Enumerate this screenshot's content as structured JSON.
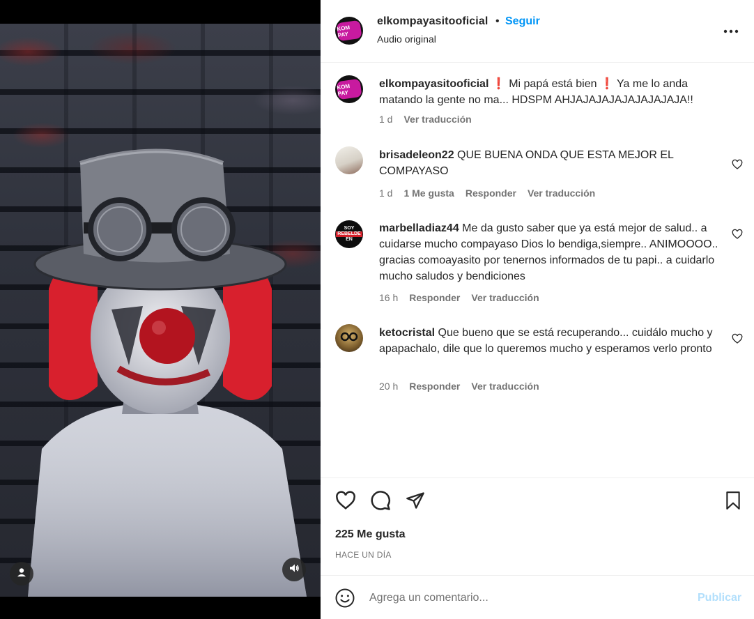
{
  "header": {
    "username": "elkompayasitooficial",
    "separator": "•",
    "follow_label": "Seguir",
    "subtitle": "Audio original",
    "avatar_text": "KOM PAY"
  },
  "comments": [
    {
      "username": "elkompayasitooficial",
      "text": " ❗ Mi papá está bien ❗ Ya me lo anda matando la gente no ma... HDSPM AHJAJAJAJAJAJAJAJAJA!!",
      "time": "1 d",
      "translate": "Ver traducción"
    },
    {
      "username": "brisadeleon22",
      "text": " QUE BUENA ONDA QUE ESTA MEJOR EL COMPAYASO",
      "time": "1 d",
      "likes": "1 Me gusta",
      "reply": "Responder",
      "translate": "Ver traducción"
    },
    {
      "username": "marbelladiaz44",
      "text": " Me da gusto saber que ya está mejor de salud.. a cuidarse mucho compayaso Dios lo bendiga,siempre.. ANIMOOOO.. gracias comoayasito por tenernos informados de tu papi.. a cuidarlo mucho saludos y bendiciones",
      "time": "16 h",
      "reply": "Responder",
      "translate": "Ver traducción",
      "avatar_text_1": "SOY",
      "avatar_text_2": "REBELDE",
      "avatar_text_3": "EN"
    },
    {
      "username": "ketocristal",
      "text": " Que bueno que se está recuperando... cuidálo mucho y apapachalo, dile que lo queremos mucho y esperamos verlo pronto",
      "time": "20 h",
      "reply": "Responder",
      "translate": "Ver traducción"
    }
  ],
  "footer": {
    "likes": "225 Me gusta",
    "posted": "HACE UN DÍA",
    "comment_placeholder": "Agrega un comentario...",
    "publish_label": "Publicar"
  },
  "colors": {
    "accent": "#0095f6",
    "publish_disabled": "#b2dffc",
    "brand_pink": "#c81a9f",
    "clown_red": "#e02434"
  },
  "icons": {
    "like": "heart-icon",
    "comment": "comment-bubble-icon",
    "share": "paper-plane-icon",
    "save": "bookmark-icon",
    "more": "more-options-icon",
    "emoji": "emoji-icon",
    "sound": "speaker-icon",
    "user_tag": "user-tag-icon"
  }
}
